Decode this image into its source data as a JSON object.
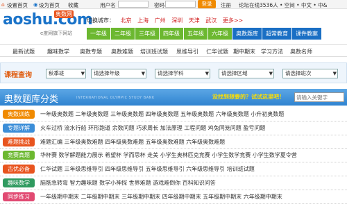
{
  "topbar": {
    "home": "设置首页",
    "sethome": "设为首页",
    "favorite": "收藏",
    "username_label": "用户名",
    "password_label": "密码",
    "login": "登录",
    "register": "注册",
    "online": "论坛在线3536人 • 空间 • 中文 • 中&"
  },
  "logo": {
    "main": "aoshu",
    "tld": ".com",
    "badge": "奥数网",
    "slogan": "e度网旗下网站"
  },
  "city": {
    "label": "切换城市：",
    "items": [
      "北京",
      "上海",
      "广州",
      "深圳",
      "天津",
      "武汉",
      "更多>>"
    ]
  },
  "grades": [
    "一年级",
    "二年级",
    "三年级",
    "四年级",
    "五年级",
    "六年级",
    "奥数题库",
    "超常教育",
    "课件教案"
  ],
  "subnav": [
    "最新试题",
    "趣味数学",
    "奥数专题",
    "奥数难题",
    "培训班试题",
    "思维导引",
    "仁华试题",
    "期中期末",
    "学习方法",
    "奥数名师"
  ],
  "filter": {
    "label": "课程查询",
    "selects": [
      "秋季班",
      "请选择年级",
      "请选择学科",
      "请选择区域",
      "请选择班次"
    ],
    "go": "查询"
  },
  "section": {
    "title": "奥数题库分类",
    "subtitle_en": "INTERNATIONAL OLYMPIC STUDY BANK",
    "question": "没找到想要的？试试这里吧！",
    "search_placeholder": "请输入关键字"
  },
  "rows": [
    {
      "tag": "奥数训练",
      "items": "一年级奥数题  二年级奥数题  三年级奥数题  四年级奥数题  五年级奥数题  六年级奥数题  小升初奥数题"
    },
    {
      "tag": "专题详解",
      "items": "火车过桥  流水行船  环形跑道  余数问题  巧求周长  加法原理  工程问题  鸡兔同笼问题  盈亏问题"
    },
    {
      "tag": "难题挑战",
      "items": "难题汇编  三年级奥数难题  四年级奥数难题  五年级奥数难题  六年级奥数难题"
    },
    {
      "tag": "竞赛真题",
      "items": "华杯赛  数学解题能力展示  希望杯  学而思杯  走美  小学生奥林匹克竞赛  小学生数学竞赛  小学生数学夏令营"
    },
    {
      "tag": "古优必备",
      "items": "仁华试题  三年级思维导引  四年级思维导引  五年级思维导引  六年级思维导引  培训班试题"
    },
    {
      "tag": "趣味数学",
      "items": "脑筋急转弯  智力趣味题  数学小神探  世界难题  游戏难倒你  百科知识问答"
    },
    {
      "tag": "同步练习",
      "items": "一年级期中期末  二年级期中期末  三年级期中期末  四年级期中期末  五年级期中期末  六年级期中期末"
    }
  ]
}
